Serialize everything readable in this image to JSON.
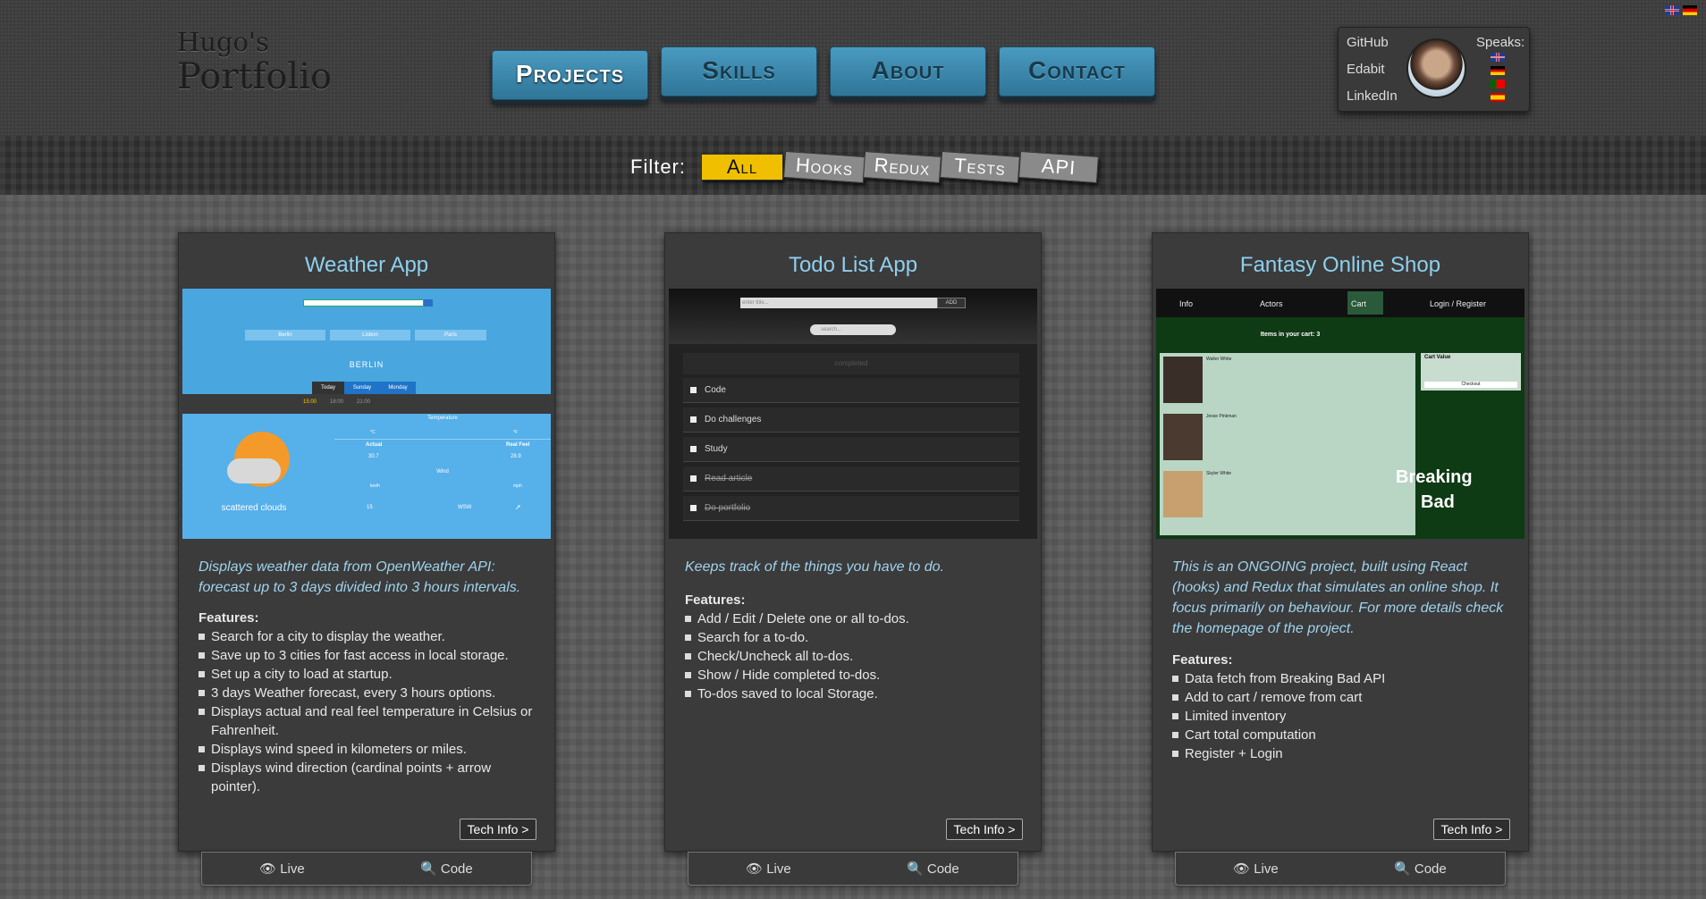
{
  "logo": {
    "line1": "Hugo's",
    "line2": "Portfolio"
  },
  "nav": [
    "Projects",
    "Skills",
    "About",
    "Contact"
  ],
  "social": {
    "links": [
      "GitHub",
      "Edabit",
      "LinkedIn"
    ],
    "speaks": "Speaks:"
  },
  "filter": {
    "label": "Filter:",
    "chips": [
      "All",
      "Hooks",
      "Redux",
      "Tests",
      "API"
    ],
    "active": "All"
  },
  "colors": {
    "accent": "#8ecfee",
    "nav": "#3a87ad",
    "filter_active": "#f0c000"
  },
  "cards": [
    {
      "title": "Weather App",
      "description": "Displays weather data from OpenWeather API: forecast up to 3 days divided into 3 hours intervals.",
      "features_label": "Features:",
      "features": [
        "Search for a city to display the weather.",
        "Save up to 3 cities for fast access in local storage.",
        "Set up a city to load at startup.",
        "3 days Weather forecast, every 3 hours options.",
        "Displays actual and real feel temperature in Celsius or Fahrenheit.",
        "Displays wind speed in kilometers or miles.",
        "Displays wind direction (cardinal points + arrow pointer)."
      ],
      "tech": "Tech Info >",
      "shot": {
        "cities": [
          "Berlin",
          "Lisbon",
          "Paris"
        ],
        "city": "BERLIN",
        "days": [
          "Today",
          "Sunday",
          "Monday"
        ],
        "hours": [
          "15:00",
          "18:00",
          "21:00"
        ],
        "temp_label": "Temperature",
        "units_temp": [
          "°C",
          "°F"
        ],
        "actual_label": "Actual",
        "real_label": "Real Feel",
        "actual": "30.7",
        "real": "28.9",
        "wind_label": "Wind",
        "units_wind": [
          "km/h",
          "mph"
        ],
        "wind_speed": "15",
        "wind_dir": "WSW",
        "condition": "scattered clouds"
      }
    },
    {
      "title": "Todo List App",
      "description": "Keeps track of the things you have to do.",
      "features_label": "Features:",
      "features": [
        "Add / Edit / Delete one or all to-dos.",
        "Search for a to-do.",
        "Check/Uncheck all to-dos.",
        "Show / Hide completed to-dos.",
        "To-dos saved to local Storage."
      ],
      "tech": "Tech Info >",
      "shot": {
        "placeholder": "enter title...",
        "add": "ADD",
        "search": "search...",
        "completed": "completed",
        "todos": [
          "Code",
          "Do challenges",
          "Study",
          "Read article",
          "Do portfolio"
        ]
      }
    },
    {
      "title": "Fantasy Online Shop",
      "description": "This is an ONGOING project, built using React (hooks) and Redux that simulates an online shop. It focus primarily on behaviour. For more details check the homepage of the project.",
      "features_label": "Features:",
      "features": [
        "Data fetch from Breaking Bad API",
        "Add to cart / remove from cart",
        "Limited inventory",
        "Cart total computation",
        "Register + Login"
      ],
      "tech": "Tech Info >",
      "shot": {
        "nav": [
          "Info",
          "Actors",
          "Cart",
          "Login / Register"
        ],
        "items_title": "Items in your cart: 3",
        "people": [
          "Walter White",
          "Jesse Pinkman",
          "Skyler White"
        ],
        "cart_value": "Cart Value",
        "checkout": "Checkout",
        "brand1": "Breaking",
        "brand2": "Bad"
      }
    }
  ],
  "actions": {
    "live": "Live",
    "code": "Code"
  }
}
